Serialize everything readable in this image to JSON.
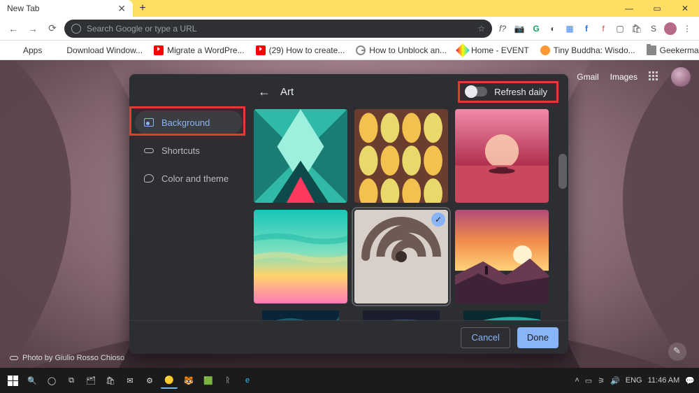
{
  "window": {
    "tab_title": "New Tab",
    "min": "—",
    "max": "▭",
    "close": "✕",
    "newtab": "+",
    "tabclose": "✕"
  },
  "toolbar": {
    "back": "←",
    "fwd": "→",
    "reload": "⟳",
    "placeholder": "Search Google or type a URL",
    "star": "☆",
    "f_q": "f?",
    "menu": "⋮"
  },
  "bookmarks": {
    "apps": "Apps",
    "items": [
      "Download Window...",
      "Migrate a WordPre...",
      "(29) How to create...",
      "How to Unblock an...",
      "Home - EVENT",
      "Tiny Buddha: Wisdo...",
      "Geekermag"
    ]
  },
  "ntp": {
    "gmail": "Gmail",
    "images": "Images",
    "credit": "Photo by Giulio Rosso Chioso"
  },
  "dialog": {
    "title": "Art",
    "refresh": "Refresh daily",
    "sidebar": {
      "bg": "Background",
      "sc": "Shortcuts",
      "ct": "Color and theme"
    },
    "cancel": "Cancel",
    "done": "Done"
  },
  "taskbar": {
    "lang": "ENG",
    "time": "11:46 AM"
  }
}
